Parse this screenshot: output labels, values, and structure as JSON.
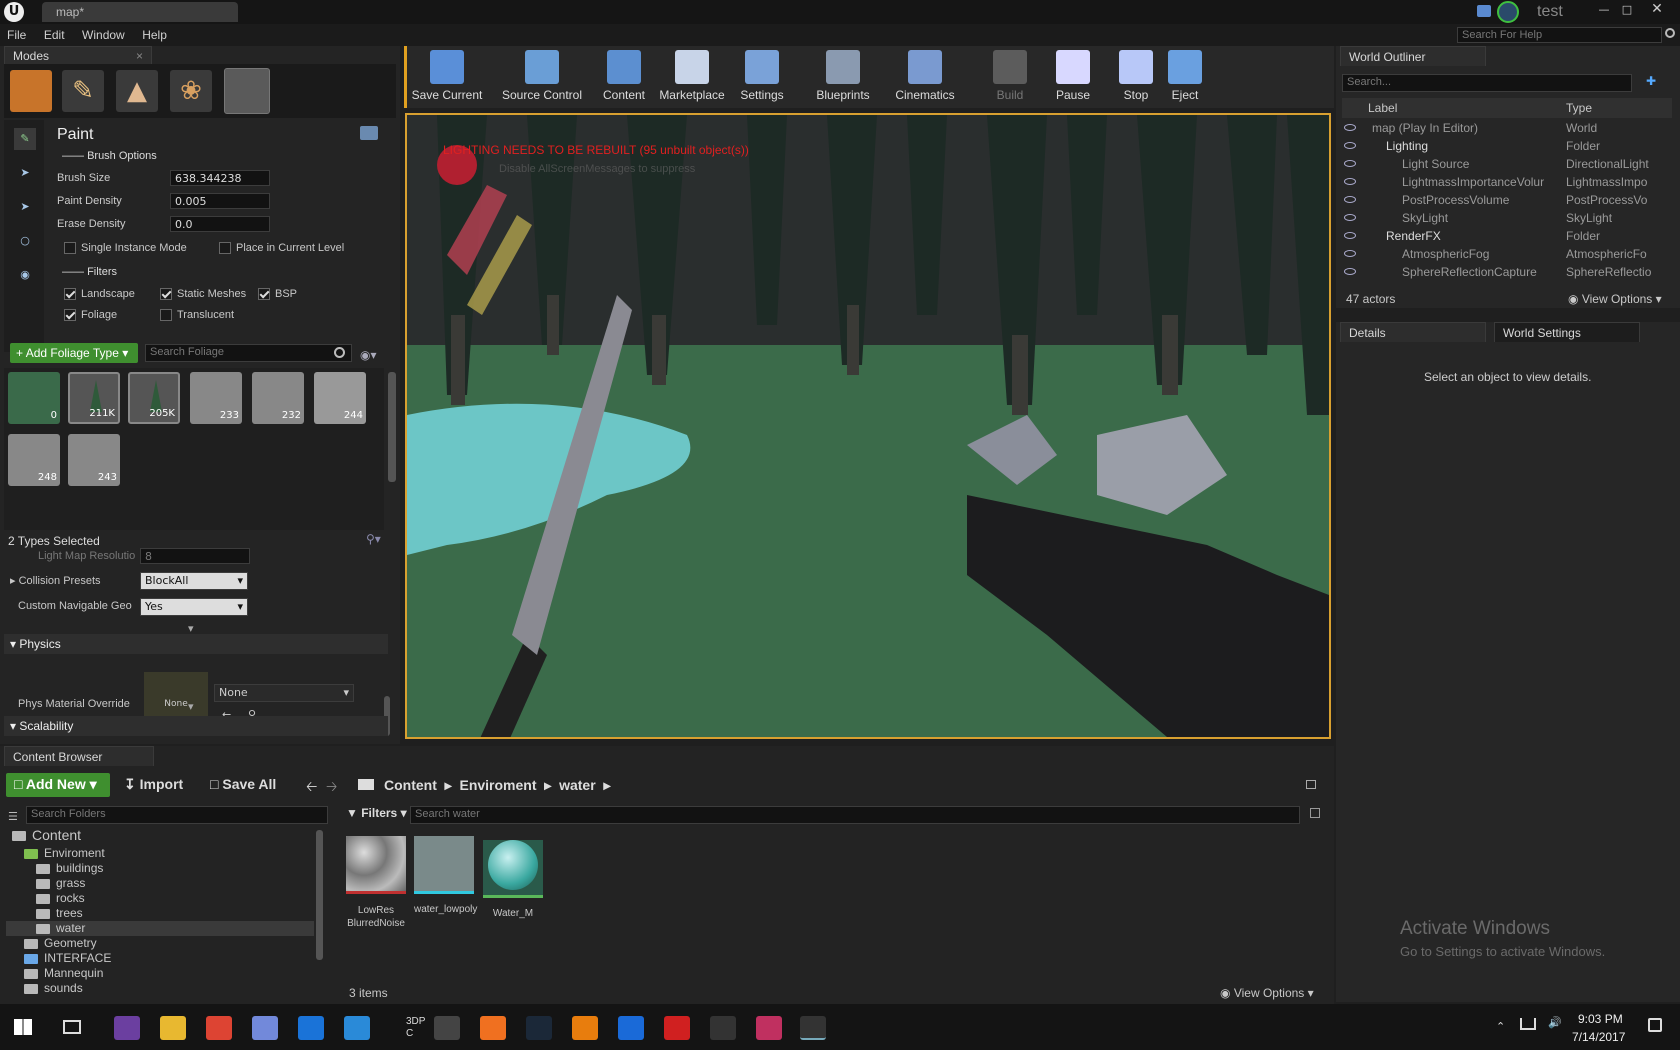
{
  "titlebar": {
    "tab": "map*",
    "user": "test",
    "search_placeholder": "Search For Help"
  },
  "menu": [
    "File",
    "Edit",
    "Window",
    "Help"
  ],
  "modes": {
    "tab": "Modes",
    "mode": "Paint"
  },
  "brush": {
    "section": "Brush Options",
    "size_label": "Brush Size",
    "size_value": "638.344238",
    "density_label": "Paint Density",
    "density_value": "0.005",
    "erase_label": "Erase Density",
    "erase_value": "0.0",
    "single_instance": "Single Instance Mode",
    "place_current": "Place in Current Level"
  },
  "filters": {
    "section": "Filters",
    "landscape": "Landscape",
    "static_meshes": "Static Meshes",
    "bsp": "BSP",
    "foliage": "Foliage",
    "translucent": "Translucent"
  },
  "foliage": {
    "add_button": "Add Foliage Type",
    "search_placeholder": "Search Foliage",
    "counts": [
      "0",
      "211K",
      "205K",
      "233",
      "232",
      "244",
      "248",
      "243"
    ],
    "selected": "2 Types Selected"
  },
  "props": {
    "lightmap_label": "Light Map Resolutio",
    "lightmap_value": "8",
    "collision_label": "Collision Presets",
    "collision_value": "BlockAll",
    "navigable_label": "Custom Navigable Geo",
    "navigable_value": "Yes",
    "physics_section": "Physics",
    "phys_label": "Phys Material Override",
    "phys_thumb": "None",
    "phys_value": "None",
    "scalability_section": "Scalability"
  },
  "toolbar": [
    {
      "label": "Save Current",
      "color": "#5a8fd8"
    },
    {
      "label": "Source Control",
      "color": "#6a9ed6"
    },
    {
      "label": "Content",
      "color": "#5c8fd0"
    },
    {
      "label": "Marketplace",
      "color": "#c8d4e8"
    },
    {
      "label": "Settings",
      "color": "#7aa2d8"
    },
    {
      "label": "Blueprints",
      "color": "#8a9ab0"
    },
    {
      "label": "Cinematics",
      "color": "#7a9ad0"
    },
    {
      "label": "Build",
      "color": "#5c5c5c"
    },
    {
      "label": "Pause",
      "color": "#d8d8ff"
    },
    {
      "label": "Stop",
      "color": "#b8c8f8"
    },
    {
      "label": "Eject",
      "color": "#6aa0e0"
    }
  ],
  "viewport": {
    "warning": "LIGHTING NEEDS TO BE REBUILT (95 unbuilt object(s))",
    "faded": "Disable AllScreenMessages to suppress"
  },
  "outliner": {
    "tab": "World Outliner",
    "search_placeholder": "Search...",
    "col_label": "Label",
    "col_type": "Type",
    "rows": [
      {
        "label": "map (Play In Editor)",
        "type": "World"
      },
      {
        "label": "Lighting",
        "type": "Folder"
      },
      {
        "label": "Light Source",
        "type": "DirectionalLight"
      },
      {
        "label": "LightmassImportanceVolur",
        "type": "LightmassImpo"
      },
      {
        "label": "PostProcessVolume",
        "type": "PostProcessVo"
      },
      {
        "label": "SkyLight",
        "type": "SkyLight"
      },
      {
        "label": "RenderFX",
        "type": "Folder"
      },
      {
        "label": "AtmosphericFog",
        "type": "AtmosphericFo"
      },
      {
        "label": "SphereReflectionCapture",
        "type": "SphereReflectio"
      }
    ],
    "count": "47 actors",
    "view_options": "View Options"
  },
  "details": {
    "tab": "Details",
    "tab2": "World Settings",
    "empty": "Select an object to view details."
  },
  "watermark": {
    "line1": "Activate Windows",
    "line2": "Go to Settings to activate Windows."
  },
  "content_browser": {
    "tab": "Content Browser",
    "add_new": "Add New",
    "import": "Import",
    "save_all": "Save All",
    "path": [
      "Content",
      "Enviroment",
      "water"
    ],
    "folder_search": "Search Folders",
    "filters": "Filters",
    "asset_search": "Search water",
    "tree": [
      "Content",
      "Enviroment",
      "buildings",
      "grass",
      "rocks",
      "trees",
      "water",
      "Geometry",
      "INTERFACE",
      "Mannequin",
      "sounds"
    ],
    "assets": [
      "LowRes BlurredNoise",
      "water_lowpoly",
      "Water_M"
    ],
    "count": "3 items",
    "view_options": "View Options"
  },
  "taskbar": {
    "time": "9:03 PM",
    "date": "7/14/2017",
    "cortana": "3DP C"
  }
}
